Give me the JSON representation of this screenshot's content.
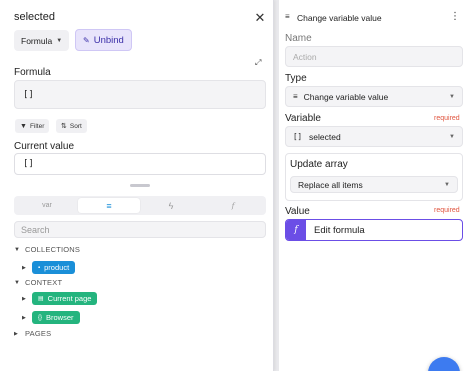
{
  "left": {
    "title": "selected",
    "close_icon": "close-icon",
    "mode_chip": "Formula",
    "unbind_label": "Unbind",
    "formula_label": "Formula",
    "formula_value": "[]",
    "filter_label": "Filter",
    "sort_label": "Sort",
    "current_value_label": "Current value",
    "current_value": "[]",
    "tabs": [
      "var",
      "database-icon",
      "flash-icon",
      "function-icon"
    ],
    "search_placeholder": "Search",
    "tree": {
      "collections_label": "COLLECTIONS",
      "product_label": "product",
      "context_label": "CONTEXT",
      "current_page_label": "Current page",
      "browser_label": "Browser",
      "pages_label": "PAGES"
    }
  },
  "right": {
    "header_title": "Change variable value",
    "name_label": "Name",
    "name_placeholder": "Action",
    "type_label": "Type",
    "type_value": "Change variable value",
    "variable_label": "Variable",
    "required_text": "required",
    "variable_value": "selected",
    "variable_prefix": "[]",
    "update_array_label": "Update array",
    "update_array_value": "Replace all items",
    "value_label": "Value",
    "value_required_text": "required",
    "value_button": "Edit formula"
  },
  "colors": {
    "accent_purple": "#6b4ee6",
    "tag_blue": "#1a8fd8",
    "tag_green": "#24b47e",
    "required_red": "#e0553f"
  }
}
